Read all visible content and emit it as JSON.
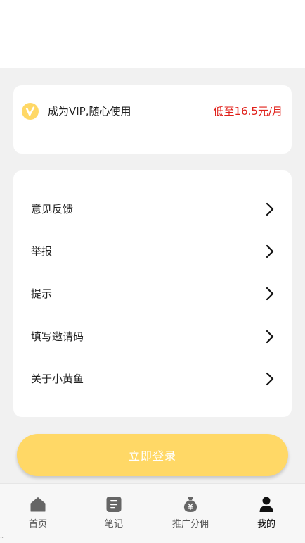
{
  "vip": {
    "icon": "vip-v-icon",
    "label": "成为VIP,随心使用",
    "price": "低至16.5元/月",
    "badge_color": "#ffd866",
    "price_color": "#e0201a"
  },
  "menu": {
    "items": [
      {
        "label": "意见反馈",
        "icon": "chevron-right-icon"
      },
      {
        "label": "举报",
        "icon": "chevron-right-icon"
      },
      {
        "label": "提示",
        "icon": "chevron-right-icon"
      },
      {
        "label": "填写邀请码",
        "icon": "chevron-right-icon"
      },
      {
        "label": "关于小黄鱼",
        "icon": "chevron-right-icon"
      }
    ]
  },
  "login": {
    "label": "立即登录",
    "color": "#ffd866"
  },
  "tabbar": {
    "active_index": 3,
    "tabs": [
      {
        "label": "首页",
        "icon": "home-icon"
      },
      {
        "label": "笔记",
        "icon": "note-icon"
      },
      {
        "label": "推广分佣",
        "icon": "money-bag-icon"
      },
      {
        "label": "我的",
        "icon": "user-icon"
      }
    ],
    "active_color": "#111111",
    "inactive_color": "#555555"
  }
}
